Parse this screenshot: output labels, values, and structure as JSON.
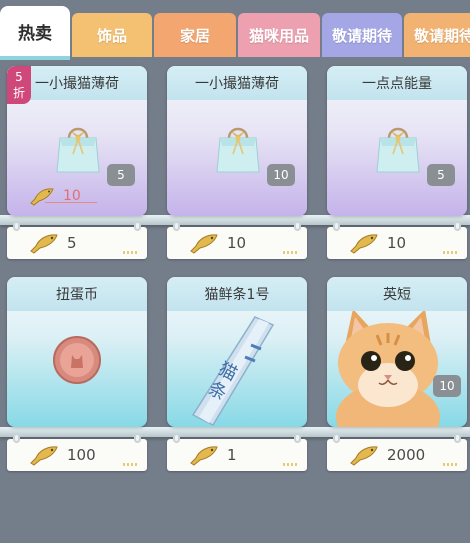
{
  "tabs": [
    {
      "label": "热卖",
      "active": true,
      "color": "#ffffff"
    },
    {
      "label": "饰品",
      "active": false,
      "color": "#f4c072"
    },
    {
      "label": "家居",
      "active": false,
      "color": "#f3a66f"
    },
    {
      "label": "猫咪用品",
      "active": false,
      "color": "#eda0b0"
    },
    {
      "label": "敬请期待",
      "active": false,
      "color": "#a4a6e6"
    },
    {
      "label": "敬请期待",
      "active": false,
      "color": "#f2b372"
    }
  ],
  "products": [
    {
      "title": "一小撮猫薄荷",
      "qty": "5",
      "price": "5",
      "discount": {
        "num": "5",
        "unit": "折"
      },
      "old_price": "10",
      "icon": "gift-bag-icon"
    },
    {
      "title": "一小撮猫薄荷",
      "qty": "10",
      "price": "10",
      "icon": "gift-bag-icon"
    },
    {
      "title": "一点点能量",
      "qty": "5",
      "price": "10",
      "icon": "gift-bag-icon"
    },
    {
      "title": "扭蛋币",
      "price": "100",
      "icon": "coin-icon"
    },
    {
      "title": "猫鲜条1号",
      "price": "1",
      "icon": "cat-treat-stick-icon",
      "pack_text": "猫 条"
    },
    {
      "title": "英短",
      "qty": "10",
      "price": "2000",
      "icon": "british-shorthair-cat-icon"
    }
  ],
  "currency_icon": "dried-fish-icon"
}
